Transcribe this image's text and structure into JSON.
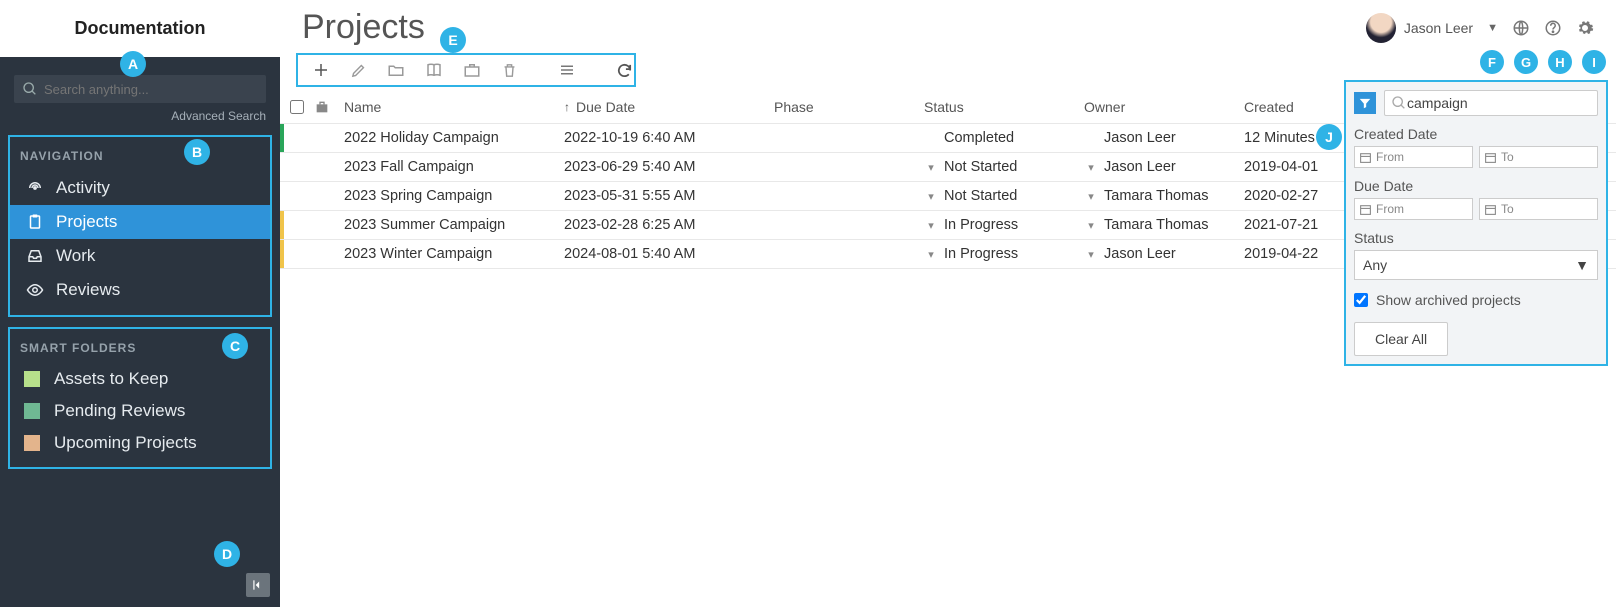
{
  "sidebar": {
    "header": "Documentation",
    "search_placeholder": "Search anything...",
    "advanced_search": "Advanced Search",
    "nav_title": "NAVIGATION",
    "nav_items": [
      {
        "label": "Activity",
        "icon": "signal-icon",
        "active": false
      },
      {
        "label": "Projects",
        "icon": "clipboard-icon",
        "active": true
      },
      {
        "label": "Work",
        "icon": "inbox-icon",
        "active": false
      },
      {
        "label": "Reviews",
        "icon": "eye-icon",
        "active": false
      }
    ],
    "folders_title": "SMART FOLDERS",
    "folders": [
      {
        "label": "Assets to Keep",
        "color": "#b7e08b"
      },
      {
        "label": "Pending Reviews",
        "color": "#6fb893"
      },
      {
        "label": "Upcoming Projects",
        "color": "#e3b48c"
      }
    ]
  },
  "badges": {
    "A": "A",
    "B": "B",
    "C": "C",
    "D": "D",
    "E": "E",
    "F": "F",
    "G": "G",
    "H": "H",
    "I": "I",
    "J": "J"
  },
  "header": {
    "page_title": "Projects",
    "user_name": "Jason Leer"
  },
  "table": {
    "columns": {
      "name": "Name",
      "due_date": "Due Date",
      "phase": "Phase",
      "status": "Status",
      "owner": "Owner",
      "created": "Created"
    },
    "rows": [
      {
        "stripe": "#2aa65a",
        "name": "2022 Holiday Campaign",
        "due": "2022-10-19 6:40 AM",
        "phase": "",
        "status": "Completed",
        "status_chev": false,
        "owner": "Jason Leer",
        "owner_chev": false,
        "created": "12 Minutes ..."
      },
      {
        "stripe": "",
        "name": "2023 Fall Campaign",
        "due": "2023-06-29 5:40 AM",
        "phase": "",
        "status": "Not Started",
        "status_chev": true,
        "owner": "Jason Leer",
        "owner_chev": true,
        "created": "2019-04-01"
      },
      {
        "stripe": "",
        "name": "2023 Spring Campaign",
        "due": "2023-05-31 5:55 AM",
        "phase": "",
        "status": "Not Started",
        "status_chev": true,
        "owner": "Tamara Thomas",
        "owner_chev": true,
        "created": "2020-02-27"
      },
      {
        "stripe": "#f0c44a",
        "name": "2023 Summer Campaign",
        "due": "2023-02-28 6:25 AM",
        "phase": "",
        "status": "In Progress",
        "status_chev": true,
        "owner": "Tamara Thomas",
        "owner_chev": true,
        "created": "2021-07-21"
      },
      {
        "stripe": "#f0c44a",
        "name": "2023 Winter Campaign",
        "due": "2024-08-01 5:40 AM",
        "phase": "",
        "status": "In Progress",
        "status_chev": true,
        "owner": "Jason Leer",
        "owner_chev": true,
        "created": "2019-04-22"
      }
    ]
  },
  "filter": {
    "search_value": "campaign",
    "created_label": "Created Date",
    "due_label": "Due Date",
    "from_placeholder": "From",
    "to_placeholder": "To",
    "status_label": "Status",
    "status_value": "Any",
    "archived_label": "Show archived projects",
    "archived_checked": true,
    "clear_label": "Clear All"
  }
}
